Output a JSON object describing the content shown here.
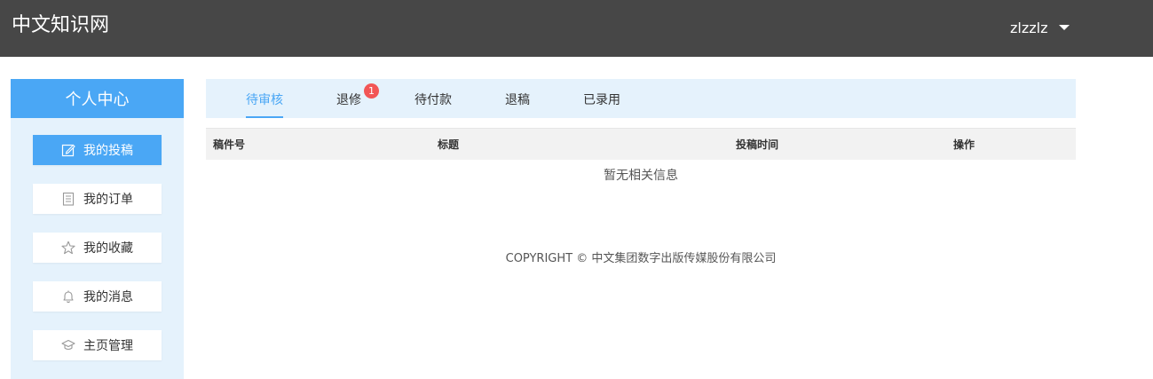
{
  "header": {
    "site_title": "中文知识网",
    "username": "zlzzlz"
  },
  "sidebar": {
    "title": "个人中心",
    "items": [
      {
        "label": "我的投稿",
        "icon": "edit-icon",
        "active": true
      },
      {
        "label": "我的订单",
        "icon": "document-icon",
        "active": false
      },
      {
        "label": "我的收藏",
        "icon": "star-icon",
        "active": false
      },
      {
        "label": "我的消息",
        "icon": "bell-icon",
        "active": false
      },
      {
        "label": "主页管理",
        "icon": "graduation-cap-icon",
        "active": false
      }
    ]
  },
  "tabs": [
    {
      "label": "待审核",
      "active": true
    },
    {
      "label": "退修",
      "badge": "1"
    },
    {
      "label": "待付款"
    },
    {
      "label": "退稿"
    },
    {
      "label": "已录用"
    }
  ],
  "table": {
    "columns": [
      "稿件号",
      "标题",
      "投稿时间",
      "操作"
    ],
    "empty_text": "暂无相关信息"
  },
  "footer": {
    "copyright": "COPYRIGHT © 中文集团数字出版传媒股份有限公司"
  },
  "colors": {
    "accent": "#4aa7f5",
    "topbar": "#474747",
    "panel": "#e5f2fc",
    "badge": "#f25656"
  }
}
